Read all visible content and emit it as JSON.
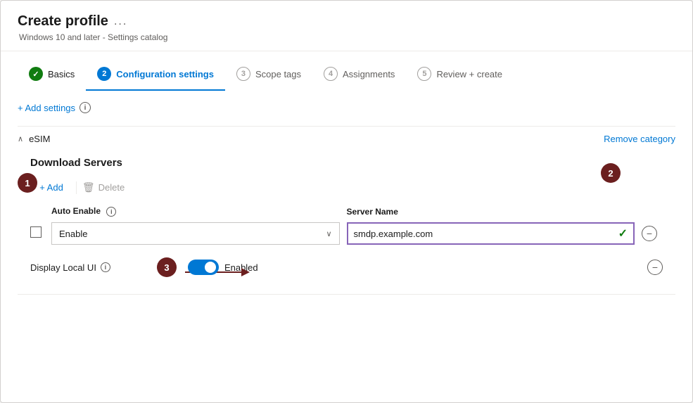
{
  "header": {
    "title": "Create profile",
    "subtitle": "Windows 10 and later - Settings catalog",
    "ellipsis": "..."
  },
  "tabs": [
    {
      "id": "basics",
      "label": "Basics",
      "number": "✓",
      "state": "completed"
    },
    {
      "id": "configuration",
      "label": "Configuration settings",
      "number": "2",
      "state": "active"
    },
    {
      "id": "scope",
      "label": "Scope tags",
      "number": "3",
      "state": "inactive"
    },
    {
      "id": "assignments",
      "label": "Assignments",
      "number": "4",
      "state": "inactive"
    },
    {
      "id": "review",
      "label": "Review + create",
      "number": "5",
      "state": "inactive"
    }
  ],
  "add_settings": {
    "label": "+ Add settings",
    "info": "i"
  },
  "category": {
    "name": "eSIM",
    "remove_label": "Remove category"
  },
  "section": {
    "title": "Download Servers"
  },
  "toolbar": {
    "add_label": "+ Add",
    "delete_label": "Delete"
  },
  "table": {
    "columns": [
      "Auto Enable",
      "Server Name"
    ],
    "auto_enable_info": "i",
    "row": {
      "enable_value": "Enable",
      "server_value": "smdp.example.com"
    }
  },
  "display_local": {
    "label": "Display Local UI",
    "info": "i",
    "toggle_state": "Enabled"
  },
  "callouts": [
    {
      "number": "1"
    },
    {
      "number": "2"
    },
    {
      "number": "3"
    }
  ]
}
